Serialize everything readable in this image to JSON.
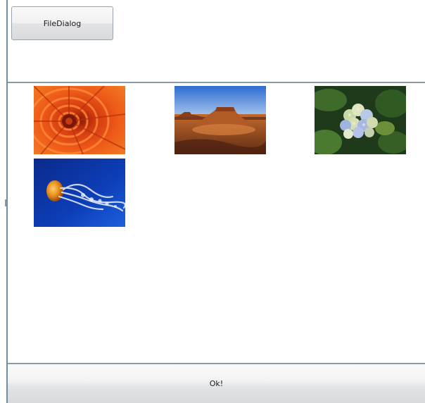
{
  "toolbar": {
    "file_dialog_label": "FileDialog"
  },
  "gallery": {
    "images": [
      {
        "name": "orange-flower-image"
      },
      {
        "name": "desert-mesa-image"
      },
      {
        "name": "hydrangea-image"
      },
      {
        "name": "jellyfish-image"
      }
    ]
  },
  "footer": {
    "ok_label": "Ok!"
  }
}
